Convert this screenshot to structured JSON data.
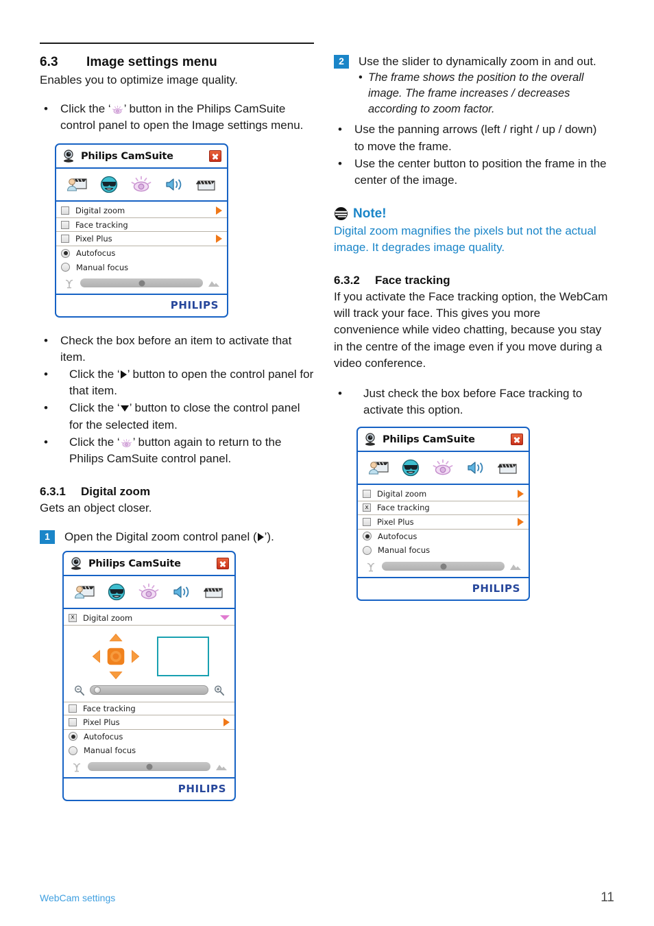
{
  "document": {
    "footer_left": "WebCam settings",
    "page_number": "11"
  },
  "left_column": {
    "section": {
      "number": "6.3",
      "title": "Image settings menu"
    },
    "intro": "Enables you to optimize image quality.",
    "open_bullet": {
      "before": "Click the ‘",
      "icon": "eye-icon",
      "after": "’ button in the Philips CamSuite control panel to open the Image settings menu."
    },
    "bullets": [
      {
        "text": "Check the box before an item to activate that item."
      },
      {
        "before": "Click the ‘",
        "icon": "triangle-right-icon",
        "after": "’ button to open the control panel for that item."
      },
      {
        "before": "Click the ‘",
        "icon": "triangle-down-icon",
        "after": "’ button to close the control panel for the selected item."
      },
      {
        "before": "Click the ‘",
        "icon": "eye-icon",
        "after": "’ button again to return to the Philips CamSuite control panel."
      }
    ],
    "subsection": {
      "number": "6.3.1",
      "title": "Digital zoom"
    },
    "subsection_intro": "Gets an object closer.",
    "step1": {
      "badge": "1",
      "before": "Open the Digital zoom control panel (",
      "icon": "triangle-right-icon",
      "after": "’)."
    }
  },
  "right_column": {
    "step2": {
      "badge": "2",
      "text": "Use the slider to dynamically zoom in and out.",
      "sub_bullets": [
        "The frame shows the position to the overall image. The frame increases / decreases according to zoom factor."
      ]
    },
    "bullets": [
      "Use the panning arrows (left / right / up / down) to move the frame.",
      "Use the center button to position the frame in the center of the image."
    ],
    "note": {
      "icon": "note-icon",
      "title": "Note!",
      "body": "Digital zoom magnifies the pixels but not the actual image. It degrades image quality.",
      "color": "#1a85c8"
    },
    "subsection": {
      "number": "6.3.2",
      "title": "Face tracking"
    },
    "subsection_body": "If you activate the Face tracking option, the WebCam will track your face. This gives you more convenience while video chatting, because you stay in the centre of the image even if you move during a video conference.",
    "bullet_activate": "Just check the box before Face tracking to activate this option."
  },
  "dialog_common": {
    "title": "Philips CamSuite",
    "webcam_icon": "webcam-icon",
    "close_icon": "close-icon",
    "brand": "PHILIPS",
    "toolbar_icons": [
      "video-call-icon",
      "fun-effects-icon",
      "image-settings-icon",
      "audio-settings-icon",
      "video-clip-icon"
    ],
    "focus_slider": {
      "min_icon": "macro-flower-icon",
      "max_icon": "mountain-icon"
    }
  },
  "dialog_1": {
    "rows": [
      {
        "type": "checkbox",
        "label": "Digital zoom",
        "checked": false,
        "trailing": "arrow-right-icon"
      },
      {
        "type": "checkbox",
        "label": "Face tracking",
        "checked": false,
        "trailing": ""
      },
      {
        "type": "checkbox",
        "label": "Pixel Plus",
        "checked": false,
        "trailing": "arrow-right-icon"
      },
      {
        "type": "radio",
        "label": "Autofocus",
        "selected": true,
        "trailing": ""
      },
      {
        "type": "radio",
        "label": "Manual focus",
        "selected": false,
        "trailing": ""
      }
    ]
  },
  "dialog_2": {
    "header_row": {
      "type": "checkbox",
      "label": "Digital zoom",
      "checked": true,
      "trailing": "chevron-down-icon",
      "check_mark": "x"
    },
    "pan_controls": {
      "up": "pan-up-button",
      "down": "pan-down-button",
      "left": "pan-left-button",
      "right": "pan-right-button",
      "center": "pan-center-button"
    },
    "frame": "zoom-frame-preview",
    "zoom_slider": {
      "min_icon": "zoom-out-icon",
      "max_icon": "zoom-in-icon"
    },
    "rows": [
      {
        "type": "checkbox",
        "label": "Face tracking",
        "checked": false,
        "trailing": ""
      },
      {
        "type": "checkbox",
        "label": "Pixel Plus",
        "checked": false,
        "trailing": "arrow-right-icon"
      },
      {
        "type": "radio",
        "label": "Autofocus",
        "selected": true,
        "trailing": ""
      },
      {
        "type": "radio",
        "label": "Manual focus",
        "selected": false,
        "trailing": ""
      }
    ]
  },
  "dialog_3": {
    "rows": [
      {
        "type": "checkbox",
        "label": "Digital zoom",
        "checked": false,
        "trailing": "arrow-right-icon"
      },
      {
        "type": "checkbox",
        "label": "Face tracking",
        "checked": true,
        "check_mark": "x",
        "trailing": ""
      },
      {
        "type": "checkbox",
        "label": "Pixel Plus",
        "checked": false,
        "trailing": "arrow-right-icon"
      },
      {
        "type": "radio",
        "label": "Autofocus",
        "selected": true,
        "trailing": ""
      },
      {
        "type": "radio",
        "label": "Manual focus",
        "selected": false,
        "trailing": ""
      }
    ]
  }
}
